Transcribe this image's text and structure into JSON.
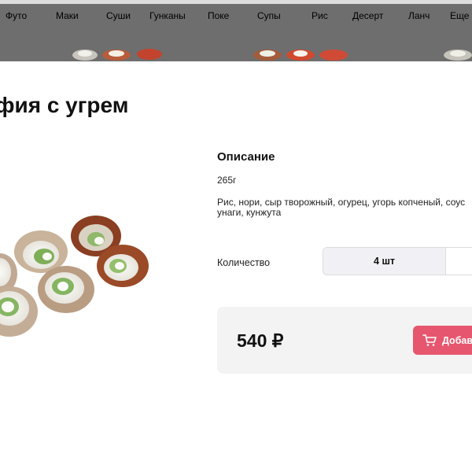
{
  "nav": {
    "items": [
      {
        "label": "Футо"
      },
      {
        "label": "Маки"
      },
      {
        "label": "Суши"
      },
      {
        "label": "Гунканы"
      },
      {
        "label": "Поке"
      },
      {
        "label": "Супы"
      },
      {
        "label": "Рис"
      },
      {
        "label": "Десерт"
      },
      {
        "label": "Ланч"
      },
      {
        "label": "Еще"
      }
    ]
  },
  "product": {
    "title": "фия с угрем",
    "description_title": "Описание",
    "weight": "265г",
    "ingredients": "Рис, нори, сыр творожный, огурец, угорь копченый, соус унаги, кунжута",
    "quantity_label": "Количество",
    "quantity_value": "4 шт",
    "price": "540 ₽",
    "add_label": "Добавить"
  },
  "colors": {
    "accent": "#e6566f",
    "header": "#6e6e6e",
    "card": "#f3f3f3"
  },
  "icons": {
    "cart": "cart-icon"
  }
}
